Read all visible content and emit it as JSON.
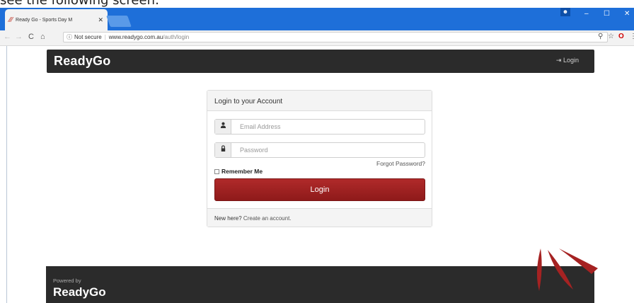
{
  "caption": "see the following screen:",
  "browser": {
    "tab_title": "Ready Go - Sports Day M",
    "tab_close": "✕",
    "security": "Not secure",
    "url_host": "www.readygo.com.au",
    "url_path": "/auth/login",
    "window_controls": [
      "–",
      "☐",
      "✕"
    ]
  },
  "app": {
    "brand": "ReadyGo",
    "nav_login": "Login"
  },
  "login": {
    "panel_title": "Login to your Account",
    "email_placeholder": "Email Address",
    "password_placeholder": "Password",
    "forgot": "Forgot Password?",
    "remember": "Remember Me",
    "remember_checked": false,
    "button": "Login",
    "new_here": "New here?",
    "create_account": "Create an account."
  },
  "footer": {
    "powered_by": "Powered by",
    "brand": "ReadyGo"
  },
  "colors": {
    "chrome_blue": "#1e6fd9",
    "nav_dark": "#2b2b2b",
    "brand_red": "#a52222"
  }
}
